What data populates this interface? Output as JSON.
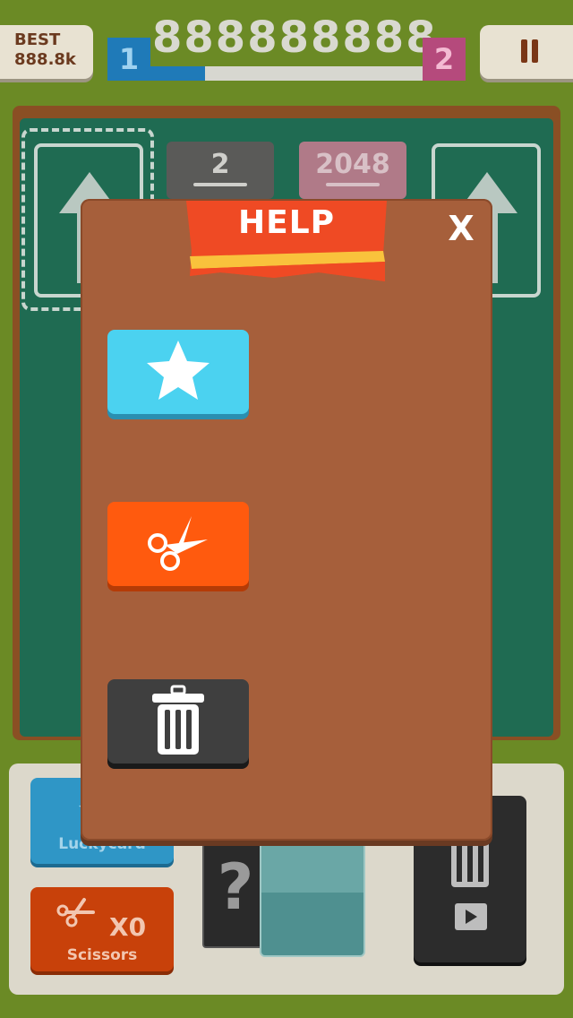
{
  "header": {
    "best_label": "BEST",
    "best_value": "888.8k",
    "score": "888888888",
    "player1": "1",
    "player2": "2",
    "progress": 0.2
  },
  "board": {
    "tiles": [
      {
        "value": "2"
      },
      {
        "value": "2048"
      }
    ]
  },
  "dialog": {
    "title": "HELP",
    "close_label": "X",
    "buttons": [
      {
        "icon": "star-icon",
        "color": "#4bd2f0"
      },
      {
        "icon": "scissors-icon",
        "color": "#ff5a0e"
      },
      {
        "icon": "trash-icon",
        "color": "#3f3f3f"
      }
    ]
  },
  "tray": {
    "lucky_card_label": "Luckycard",
    "scissors_label": "Scissors",
    "scissors_count": "X0",
    "mystery_symbol": "?"
  }
}
